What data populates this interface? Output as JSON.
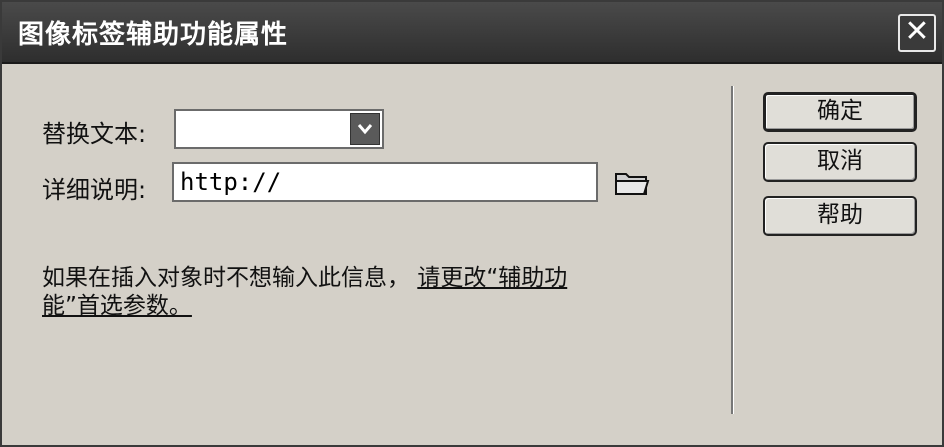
{
  "dialog": {
    "title": "图像标签辅助功能属性",
    "close_icon": "close-icon"
  },
  "form": {
    "alt_label": "替换文本:",
    "alt_value": "",
    "desc_label": "详细说明:",
    "desc_value": "http://"
  },
  "note": {
    "text": "如果在插入对象时不想输入此信息，",
    "link_part1": "请更改“辅助功",
    "link_part2": "能”首选参数。"
  },
  "buttons": {
    "ok": "确定",
    "cancel": "取消",
    "help": "帮助"
  }
}
